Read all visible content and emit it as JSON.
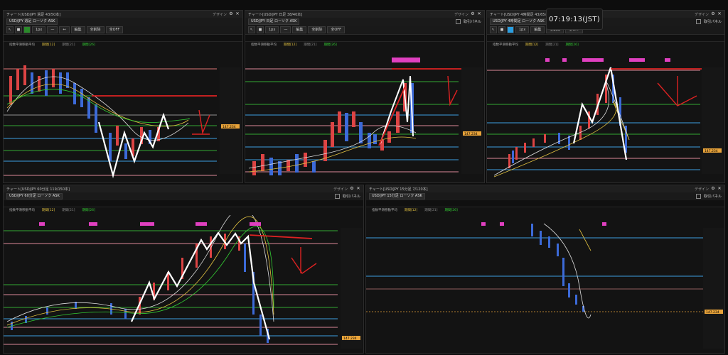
{
  "clock": "07:19:13(JST)",
  "toolbar": {
    "cross": "✛",
    "rect": "▭",
    "hline": "—",
    "pan": "✥",
    "zoom_in": "+",
    "zoom_out": "−",
    "fit": "⤢",
    "edit": "編集",
    "full": "全削除",
    "all_off": "全OFF",
    "panel_label": "取引パネル",
    "period": "1px"
  },
  "legend": {
    "label": "指数平滑移動平均",
    "s1": "期間[12]",
    "s2": "期間[21]",
    "s3": "期間[26]"
  },
  "panels": [
    {
      "title": "チャート[USD/JPY 週足 43/50本]",
      "symbol": "USD/JPY 週足 ローソク ASK",
      "design": "デザイン"
    },
    {
      "title": "チャート[USD/JPY 日足 38/40本]",
      "symbol": "USD/JPY 日足 ローソク ASK",
      "design": "デザイン"
    },
    {
      "title": "チャート[USD/JPY 4時間足 43/65本]",
      "symbol": "USD/JPY 4時間足 ローソク ASK",
      "design": "デザイン"
    },
    {
      "title": "チャート[USD/JPY 60分足 119/150本]",
      "symbol": "USD/JPY 60分足 ローソク ASK",
      "design": "デザイン"
    },
    {
      "title": "チャート[USD/JPY 15分足 7/120本]",
      "symbol": "USD/JPY 15分足 ローソク ASK",
      "design": "デザイン"
    }
  ],
  "price_tag": "147.234"
}
